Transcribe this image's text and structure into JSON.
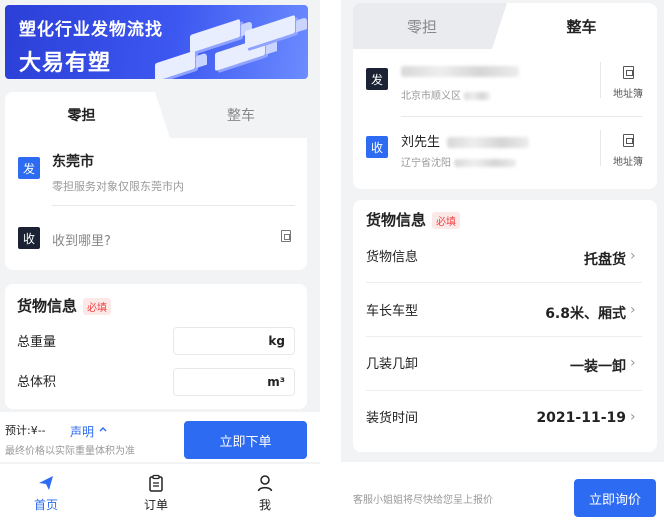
{
  "left": {
    "banner": {
      "line1": "塑化行业发物流找",
      "line2": "大易有塑"
    },
    "tabs": [
      {
        "label": "零担",
        "active": true
      },
      {
        "label": "整车",
        "active": false
      }
    ],
    "sender": {
      "badge": "发",
      "city": "东莞市",
      "note": "零担服务对象仅限东莞市内"
    },
    "receiver": {
      "badge": "收",
      "placeholder": "收到哪里?"
    },
    "goods": {
      "title": "货物信息",
      "required": "必填",
      "weight_label": "总重量",
      "weight_unit": "kg",
      "volume_label": "总体积",
      "volume_unit": "m³"
    },
    "footer": {
      "estimate": "预计:¥--",
      "declare": "声明",
      "note": "最终价格以实际重量体积为准",
      "order_button": "立即下单"
    },
    "nav": [
      {
        "label": "首页",
        "icon": "send-icon",
        "active": true
      },
      {
        "label": "订单",
        "icon": "clipboard-icon",
        "active": false
      },
      {
        "label": "我",
        "icon": "user-icon",
        "active": false
      }
    ]
  },
  "right": {
    "tabs": [
      {
        "label": "零担",
        "active": false
      },
      {
        "label": "整车",
        "active": true
      }
    ],
    "sender": {
      "badge": "发",
      "address": "北京市顺义区",
      "book_label": "地址簿"
    },
    "receiver": {
      "badge": "收",
      "name": "刘先生",
      "address": "辽宁省沈阳",
      "book_label": "地址簿"
    },
    "goods": {
      "title": "货物信息",
      "required": "必填",
      "rows": [
        {
          "label": "货物信息",
          "value": "托盘货"
        },
        {
          "label": "车长车型",
          "value": "6.8米、厢式"
        },
        {
          "label": "几装几卸",
          "value": "一装一卸"
        },
        {
          "label": "装货时间",
          "value": "2021-11-19"
        }
      ]
    },
    "footer": {
      "note": "客服小姐姐将尽快给您呈上报价",
      "ask_button": "立即询价"
    }
  },
  "colors": {
    "accent": "#2c6bf2",
    "dark_badge": "#1b2233",
    "required": "#f04040"
  }
}
